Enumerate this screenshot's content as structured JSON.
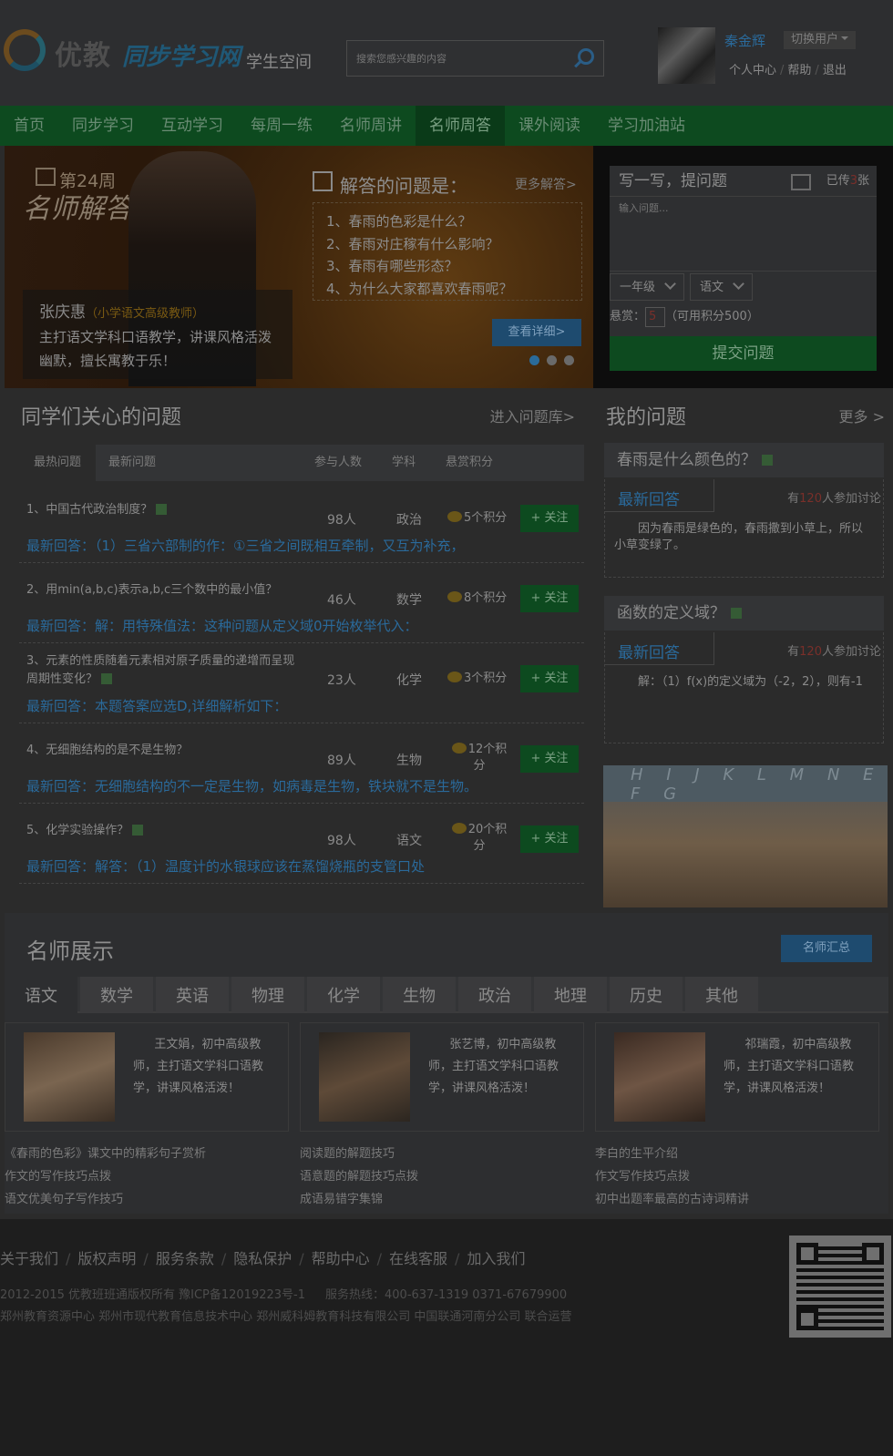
{
  "header": {
    "logo_text1": "优教",
    "logo_text2": "同步学习网",
    "subtitle": "学生空间",
    "search_placeholder": "搜索您感兴趣的内容",
    "user_name": "秦金辉",
    "switch_user": "切换用户",
    "links": [
      "个人中心",
      "帮助",
      "退出"
    ]
  },
  "nav": {
    "items": [
      "首页",
      "同步学习",
      "互动学习",
      "每周一练",
      "名师周讲",
      "名师周答",
      "课外阅读",
      "学习加油站"
    ],
    "active_index": 5
  },
  "banner": {
    "week": "第24周",
    "calligraphy": "名师解答",
    "teacher_name": "张庆惠",
    "teacher_title": "（小学语文高级教师）",
    "teacher_desc": "主打语文学科口语教学，讲课风格活泼幽默，擅长寓教于乐！",
    "question_head": "解答的问题是：",
    "more": "更多解答>",
    "questions": [
      "1、春雨的色彩是什么？",
      "2、春雨对庄稼有什么影响？",
      "3、春雨有哪些形态？",
      "4、为什么大家都喜欢春雨呢？"
    ],
    "detail_button": "查看详细>",
    "slide_count": 3,
    "active_slide": 0
  },
  "ask": {
    "title": "写一写，提问题",
    "uploaded_prefix": "已传",
    "uploaded_count": "3",
    "uploaded_suffix": "张",
    "textarea_placeholder": "输入问题...",
    "grade": "一年级",
    "subject": "语文",
    "reward_label": "悬赏：",
    "reward_value": "5",
    "reward_note": "（可用积分500）",
    "submit": "提交问题"
  },
  "hot": {
    "title": "同学们关心的问题",
    "more": "进入问题库>",
    "tabs": [
      "最热问题",
      "最新问题"
    ],
    "columns": [
      "参与人数",
      "学科",
      "悬赏积分"
    ],
    "follow_label": "+ 关注",
    "rows": [
      {
        "title": "1、中国古代政治制度？",
        "count": "98人",
        "subject": "政治",
        "points": "5个积分",
        "answer": "最新回答：（1）三省六部制的作：①三省之间既相互牵制，又互为补充，"
      },
      {
        "title": "2、用min(a,b,c)表示a,b,c三个数中的最小值？",
        "count": "46人",
        "subject": "数学",
        "points": "8个积分",
        "answer": "最新回答：解：用特殊值法：这种问题从定义域0开始枚举代入："
      },
      {
        "title": "3、元素的性质随着元素相对原子质量的递增而呈现周期性变化？",
        "count": "23人",
        "subject": "化学",
        "points": "3个积分",
        "answer": "最新回答：本题答案应选D,详细解析如下："
      },
      {
        "title": "4、无细胞结构的是不是生物？",
        "count": "89人",
        "subject": "生物",
        "points": "12个积分",
        "answer": "最新回答：无细胞结构的不一定是生物，如病毒是生物，铁块就不是生物。"
      },
      {
        "title": "5、化学实验操作？",
        "count": "98人",
        "subject": "语文",
        "points": "20个积分",
        "answer": "最新回答：解答：（1）温度计的水银球应该在蒸馏烧瓶的支管口处"
      }
    ]
  },
  "mine": {
    "title": "我的问题",
    "more": "更多 >",
    "items": [
      {
        "question": "春雨是什么颜色的？",
        "answer_label": "最新回答",
        "prefix": "有",
        "count": "120",
        "suffix": "人参加讨论",
        "answer": "因为春雨是绿色的，春雨撒到小草上，所以小草变绿了。"
      },
      {
        "question": "函数的定义域？",
        "answer_label": "最新回答",
        "prefix": "有",
        "count": "120",
        "suffix": "人参加讨论",
        "answer": "解：（1）f(x)的定义域为（-2，2），则有-1"
      }
    ],
    "board_text": "H I J K L M N E F G"
  },
  "teachers": {
    "title": "名师展示",
    "all_button": "名师汇总",
    "subjects": [
      "语文",
      "数学",
      "英语",
      "物理",
      "化学",
      "生物",
      "政治",
      "地理",
      "历史",
      "其他"
    ],
    "active_subject": 0,
    "cards": [
      {
        "desc": "王文娟，初中高级教师，主打语文学科口语教学，讲课风格活泼！",
        "links": [
          "《春雨的色彩》课文中的精彩句子赏析",
          "作文的写作技巧点拨",
          "语文优美句子写作技巧"
        ]
      },
      {
        "desc": "张艺博，初中高级教师，主打语文学科口语教学，讲课风格活泼！",
        "links": [
          "阅读题的解题技巧",
          "语意题的解题技巧点拨",
          "成语易错字集锦"
        ]
      },
      {
        "desc": "祁瑞霞，初中高级教师，主打语文学科口语教学，讲课风格活泼！",
        "links": [
          "李白的生平介绍",
          "作文写作技巧点拨",
          "初中出题率最高的古诗词精讲"
        ]
      }
    ]
  },
  "footer": {
    "links": [
      "关于我们",
      "版权声明",
      "服务条款",
      "隐私保护",
      "帮助中心",
      "在线客服",
      "加入我们"
    ],
    "copyright": "2012-2015 优教班班通版权所有 豫ICP备12019223号-1",
    "hotline": "服务热线：400-637-1319  0371-67679900",
    "operators": "郑州教育资源中心   郑州市现代教育信息技术中心   郑州威科姆教育科技有限公司 中国联通河南分公司  联合运营"
  }
}
